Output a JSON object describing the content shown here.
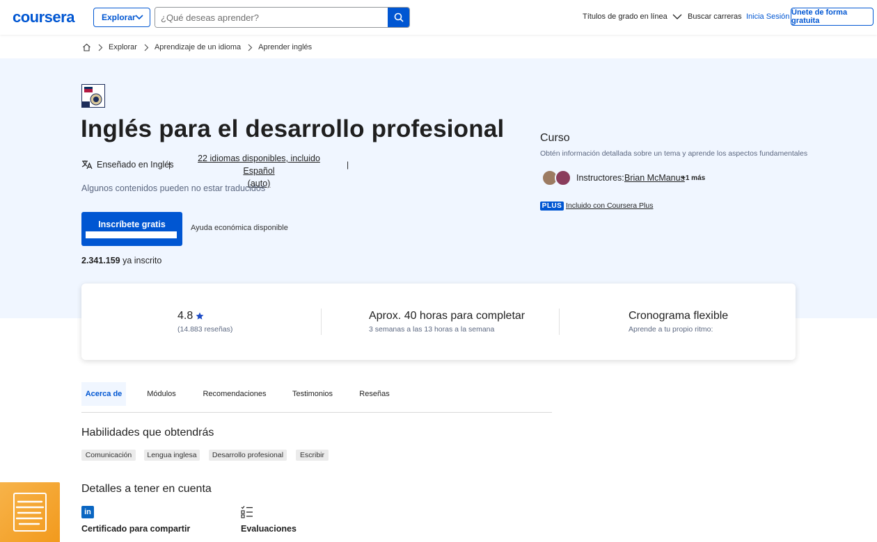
{
  "header": {
    "logo": "coursera",
    "explore_label": "Explorar",
    "search_placeholder": "¿Qué deseas aprender?",
    "degrees_label": "Títulos de grado en línea",
    "careers_label": "Buscar carreras",
    "login_label": "Inicia Sesión",
    "join_label": "Únete de forma gratuita"
  },
  "breadcrumb": [
    "Explorar",
    "Aprendizaje de un idioma",
    "Aprender inglés"
  ],
  "course": {
    "title": "Inglés para el desarrollo profesional",
    "taught_in": "Enseñado en Inglés",
    "separator": "|",
    "languages_line1": "22 idiomas disponibles, incluido Español",
    "languages_line2": "(auto)",
    "untranslated": "Algunos contenidos pueden no estar traducidos",
    "enroll_label": "Inscríbete gratis",
    "aid_label": "Ayuda económica disponible",
    "enrolled_count": "2.341.159",
    "enrolled_suffix": "ya inscrito",
    "type": "Curso",
    "type_desc": "Obtén información detallada sobre un tema y aprende los aspectos fundamentales",
    "instructors_label": "Instructores:",
    "instructor_name": "Brian McManus",
    "instructor_more": "+1 más",
    "plus_badge": "PLUS",
    "plus_label": "Incluido con Coursera Plus"
  },
  "stats": {
    "rating": "4.8",
    "reviews": "(14.883 reseñas)",
    "hours": "Aprox. 40 horas para completar",
    "hours_sub": "3 semanas a las 13 horas a la semana",
    "schedule": "Cronograma flexible",
    "schedule_sub": "Aprende a tu propio ritmo:"
  },
  "tabs": [
    "Acerca de",
    "Módulos",
    "Recomendaciones",
    "Testimonios",
    "Reseñas"
  ],
  "skills": {
    "title": "Habilidades que obtendrás",
    "items": [
      "Comunicación",
      "Lengua inglesa",
      "Desarrollo profesional",
      "Escribir"
    ]
  },
  "details": {
    "title": "Detalles a tener en cuenta",
    "certificate": "Certificado para compartir",
    "evaluations": "Evaluaciones",
    "linkedin_glyph": "in"
  },
  "colors": {
    "brand": "#0056d2",
    "hero_bg": "#f0f6ff",
    "widget": "#f29a1d"
  },
  "icons": [
    "home-icon",
    "chevron-right-icon",
    "chevron-down-icon",
    "search-icon",
    "translate-icon",
    "star-icon",
    "linkedin-icon",
    "checklist-icon"
  ]
}
